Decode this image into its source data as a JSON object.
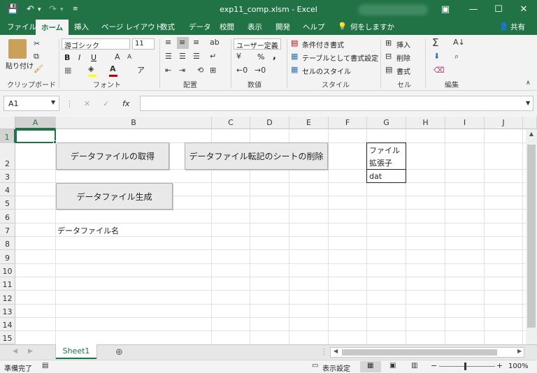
{
  "title_bar": {
    "document_title": "exp11_comp.xlsm  -  Excel",
    "icons": [
      "save-icon",
      "undo-icon",
      "redo-icon",
      "customize-qat-icon",
      "ribbon-display-icon",
      "minimize-icon",
      "maximize-icon",
      "close-icon"
    ]
  },
  "ribbon_tabs": {
    "file": "ファイル",
    "home": "ホーム",
    "insert": "挿入",
    "page_layout": "ページ レイアウト",
    "formulas": "数式",
    "data": "データ",
    "review": "校閲",
    "view": "表示",
    "developer": "開発",
    "help": "ヘルプ",
    "tell_me": "何をしますか",
    "share": "共有"
  },
  "ribbon": {
    "clipboard": {
      "paste": "貼り付け",
      "label": "クリップボード"
    },
    "font": {
      "name": "游ゴシック",
      "size": "11",
      "bold": "B",
      "italic": "I",
      "underline": "U",
      "label": "フォント",
      "font_color": "#c00000",
      "fill_color": "#ffff00"
    },
    "alignment": {
      "label": "配置"
    },
    "number": {
      "format": "ユーザー定義",
      "percent": "%",
      "comma": ",",
      "label": "数値"
    },
    "styles": {
      "conditional": "条件付き書式",
      "table": "テーブルとして書式設定",
      "cell_styles": "セルのスタイル",
      "label": "スタイル"
    },
    "cells": {
      "insert": "挿入",
      "delete": "削除",
      "format": "書式",
      "label": "セル"
    },
    "editing": {
      "label": "編集"
    }
  },
  "formula_bar": {
    "name_box": "A1",
    "fx": "fx",
    "formula": ""
  },
  "grid": {
    "columns": [
      "A",
      "B",
      "C",
      "D",
      "E",
      "F",
      "G",
      "H",
      "I",
      "J"
    ],
    "rows": [
      "1",
      "2",
      "3",
      "4",
      "5",
      "6",
      "7",
      "8",
      "9",
      "10",
      "11",
      "12",
      "13",
      "14",
      "15"
    ],
    "selected_cell": "A1",
    "buttons": {
      "get_data_file": "データファイルの取得",
      "delete_transfer_sheets": "データファイル転記のシートの削除",
      "generate_data_file": "データファイル生成"
    },
    "cells": {
      "B7": "データファイル名",
      "G2_line1": "ファイル",
      "G2_line2": "拡張子",
      "G3": "dat"
    }
  },
  "sheet_tabs": {
    "active": "Sheet1",
    "add": "⊕"
  },
  "status_bar": {
    "ready": "準備完了",
    "display_settings": "表示設定",
    "zoom": "100%"
  },
  "colors": {
    "excel_green": "#217346",
    "ribbon_bg": "#f3f3f3"
  }
}
